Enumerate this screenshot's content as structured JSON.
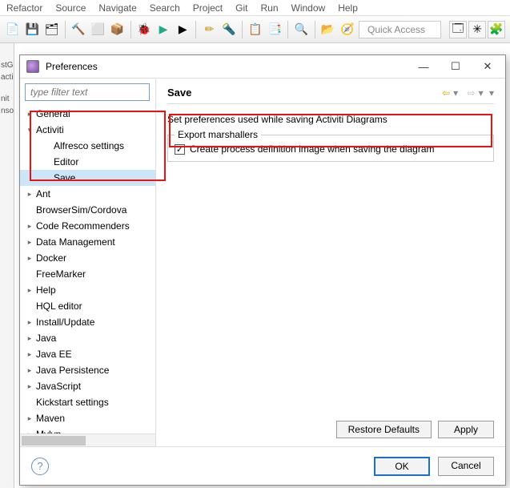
{
  "menubar": [
    "Refactor",
    "Source",
    "Navigate",
    "Search",
    "Project",
    "Git",
    "Run",
    "Window",
    "Help"
  ],
  "toolbar": {
    "quick_access": "Quick Access"
  },
  "leftstrip": [
    "stGr",
    "acti",
    "",
    "",
    "",
    "nit",
    "nsol"
  ],
  "dialog": {
    "title": "Preferences",
    "filter_placeholder": "type filter text",
    "tree": [
      {
        "label": "General",
        "exp": "closed",
        "lvl": 0
      },
      {
        "label": "Activiti",
        "exp": "open",
        "lvl": 0
      },
      {
        "label": "Alfresco settings",
        "exp": "none",
        "lvl": 1
      },
      {
        "label": "Editor",
        "exp": "none",
        "lvl": 1
      },
      {
        "label": "Save",
        "exp": "none",
        "lvl": 1,
        "selected": true
      },
      {
        "label": "Ant",
        "exp": "closed",
        "lvl": 0
      },
      {
        "label": "BrowserSim/Cordova",
        "exp": "none",
        "lvl": 0
      },
      {
        "label": "Code Recommenders",
        "exp": "closed",
        "lvl": 0
      },
      {
        "label": "Data Management",
        "exp": "closed",
        "lvl": 0
      },
      {
        "label": "Docker",
        "exp": "closed",
        "lvl": 0
      },
      {
        "label": "FreeMarker",
        "exp": "none",
        "lvl": 0
      },
      {
        "label": "Help",
        "exp": "closed",
        "lvl": 0
      },
      {
        "label": "HQL editor",
        "exp": "none",
        "lvl": 0
      },
      {
        "label": "Install/Update",
        "exp": "closed",
        "lvl": 0
      },
      {
        "label": "Java",
        "exp": "closed",
        "lvl": 0
      },
      {
        "label": "Java EE",
        "exp": "closed",
        "lvl": 0
      },
      {
        "label": "Java Persistence",
        "exp": "closed",
        "lvl": 0
      },
      {
        "label": "JavaScript",
        "exp": "closed",
        "lvl": 0
      },
      {
        "label": "Kickstart settings",
        "exp": "none",
        "lvl": 0
      },
      {
        "label": "Maven",
        "exp": "closed",
        "lvl": 0
      },
      {
        "label": "Mylyn",
        "exp": "closed",
        "lvl": 0
      }
    ],
    "page": {
      "title": "Save",
      "desc": "Set preferences used while saving Activiti Diagrams",
      "group_title": "Export marshallers",
      "checkbox_label": "Create process definition image when saving the diagram",
      "checkbox_checked": true
    },
    "buttons": {
      "restore": "Restore Defaults",
      "apply": "Apply",
      "ok": "OK",
      "cancel": "Cancel"
    }
  }
}
